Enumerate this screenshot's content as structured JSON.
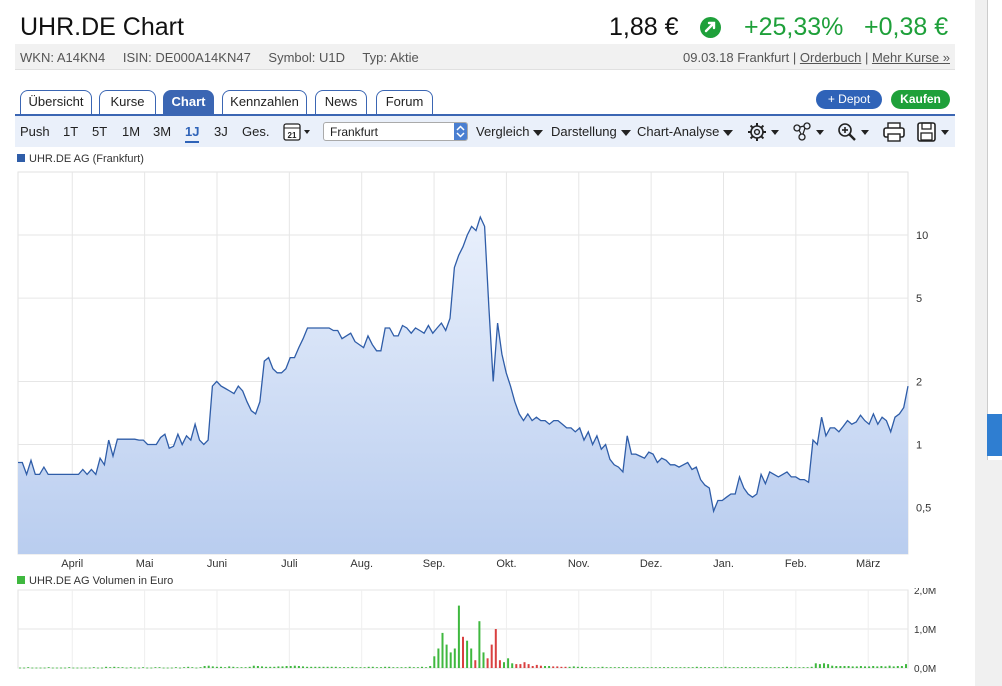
{
  "header": {
    "title": "UHR.DE Chart",
    "price": "1,88 €",
    "change_pct": "+25,33%",
    "change_abs": "+0,38 €",
    "wkn": "WKN: A14KN4",
    "isin": "ISIN: DE000A14KN47",
    "symbol": "Symbol: U1D",
    "typ": "Typ: Aktie",
    "date_place": "09.03.18 Frankfurt",
    "orderbuch": "Orderbuch",
    "mehr_kurse": "Mehr Kurse »",
    "sep": "|",
    "colors": {
      "positive": "#1ea03a",
      "accent": "#2f63b8"
    }
  },
  "tabs": [
    "Übersicht",
    "Kurse",
    "Chart",
    "Kennzahlen",
    "News",
    "Forum"
  ],
  "active_tab": "Chart",
  "buttons": {
    "depot": "+ Depot",
    "kaufen": "Kaufen"
  },
  "toolbar": {
    "ranges": [
      "Push",
      "1T",
      "5T",
      "1M",
      "3M",
      "1J",
      "3J",
      "Ges."
    ],
    "active_range": "1J",
    "calendar_day": "21",
    "exchange_select": "Frankfurt",
    "vergleich": "Vergleich",
    "darstellung": "Darstellung",
    "chartanalyse": "Chart-Analyse",
    "icons": [
      "settings-icon",
      "share-icon",
      "zoom-icon",
      "print-icon",
      "save-icon"
    ]
  },
  "chart_data": [
    {
      "type": "area",
      "series": [
        {
          "name": "UHR.DE AG (Frankfurt)",
          "color": "#2f5da8"
        }
      ],
      "x_ticks": [
        "April",
        "Mai",
        "Juni",
        "Juli",
        "Aug.",
        "Sep.",
        "Okt.",
        "Nov.",
        "Dez.",
        "Jan.",
        "Feb.",
        "März"
      ],
      "y_ticks": [
        "10",
        "5",
        "2",
        "1",
        "0,5"
      ],
      "y_scale": "log",
      "ylim": [
        0.3,
        20
      ],
      "values": [
        0.82,
        0.82,
        0.72,
        0.84,
        0.72,
        0.72,
        0.78,
        0.72,
        0.72,
        0.72,
        0.72,
        0.72,
        0.72,
        0.72,
        0.72,
        0.76,
        0.72,
        0.76,
        0.72,
        0.86,
        0.8,
        1.05,
        0.88,
        1.06,
        1.06,
        1.06,
        1.06,
        1.06,
        1.05,
        1.05,
        1.0,
        1.0,
        1.0,
        1.08,
        1.12,
        0.96,
        0.98,
        1.12,
        1.0,
        1.1,
        1.05,
        1.25,
        1.05,
        1.0,
        1.05,
        1.9,
        2.0,
        1.9,
        1.85,
        1.8,
        1.75,
        1.9,
        1.8,
        1.6,
        1.45,
        1.4,
        1.6,
        2.5,
        2.6,
        2.3,
        2.2,
        2.2,
        2.3,
        2.6,
        2.6,
        2.9,
        3.2,
        3.6,
        3.6,
        3.6,
        3.6,
        3.6,
        3.6,
        3.5,
        3.5,
        3.2,
        3.3,
        3.4,
        3.1,
        3.0,
        2.9,
        3.3,
        3.0,
        2.8,
        2.8,
        3.6,
        3.6,
        3.3,
        3.3,
        3.7,
        3.6,
        3.4,
        3.6,
        3.5,
        3.4,
        3.7,
        3.4,
        3.6,
        3.8,
        3.5,
        4.0,
        7.0,
        8.0,
        8.8,
        10.0,
        11.0,
        10.5,
        12.2,
        11.0,
        4.5,
        2.0,
        3.8,
        2.7,
        2.2,
        1.9,
        1.6,
        1.4,
        1.3,
        1.4,
        1.3,
        1.35,
        1.3,
        1.3,
        1.25,
        1.3,
        1.3,
        1.25,
        1.2,
        1.2,
        1.15,
        1.2,
        1.05,
        1.15,
        1.0,
        1.1,
        0.95,
        1.0,
        0.85,
        0.8,
        0.78,
        0.74,
        1.1,
        0.9,
        0.9,
        0.88,
        0.86,
        0.92,
        0.9,
        0.82,
        0.86,
        0.84,
        0.8,
        0.8,
        0.78,
        0.8,
        0.82,
        0.76,
        0.78,
        0.68,
        0.64,
        0.62,
        0.48,
        0.54,
        0.54,
        0.56,
        0.58,
        0.58,
        0.7,
        0.62,
        0.58,
        0.56,
        0.58,
        0.72,
        0.65,
        0.74,
        0.72,
        0.7,
        0.72,
        0.74,
        0.7,
        0.7,
        0.68,
        0.68,
        0.66,
        1.05,
        1.0,
        1.35,
        1.1,
        1.2,
        1.2,
        1.15,
        1.22,
        1.3,
        1.25,
        1.28,
        1.38,
        1.3,
        1.25,
        1.4,
        1.25,
        1.35,
        1.3,
        1.15,
        1.35,
        1.4,
        1.5,
        1.9
      ]
    },
    {
      "type": "bar",
      "series": [
        {
          "name": "UHR.DE AG Volumen in Euro",
          "color_up": "#3fb83f",
          "color_down": "#d94040"
        }
      ],
      "y_ticks": [
        "2,0M",
        "1,0M",
        "0,0M"
      ],
      "ylim": [
        0,
        2.0
      ],
      "unit": "M",
      "values": [
        0.01,
        0.01,
        0.02,
        0.01,
        0.01,
        0.01,
        0.01,
        0.02,
        0.01,
        0.01,
        0.01,
        0.01,
        0.02,
        0.01,
        0.01,
        0.01,
        0.01,
        0.01,
        0.02,
        0.01,
        0.01,
        0.03,
        0.02,
        0.03,
        0.02,
        0.02,
        0.01,
        0.02,
        0.01,
        0.01,
        0.02,
        0.01,
        0.01,
        0.02,
        0.02,
        0.01,
        0.01,
        0.01,
        0.02,
        0.01,
        0.02,
        0.03,
        0.02,
        0.01,
        0.02,
        0.05,
        0.06,
        0.04,
        0.03,
        0.03,
        0.02,
        0.04,
        0.03,
        0.02,
        0.02,
        0.02,
        0.03,
        0.06,
        0.05,
        0.04,
        0.03,
        0.03,
        0.03,
        0.04,
        0.04,
        0.05,
        0.05,
        0.06,
        0.05,
        0.04,
        0.03,
        0.03,
        0.03,
        0.03,
        0.03,
        0.03,
        0.03,
        0.03,
        0.02,
        0.02,
        0.02,
        0.03,
        0.02,
        0.02,
        0.02,
        0.03,
        0.03,
        0.02,
        0.02,
        0.03,
        0.03,
        0.02,
        0.02,
        0.02,
        0.02,
        0.03,
        0.02,
        0.02,
        0.03,
        0.02,
        0.05,
        0.3,
        0.5,
        0.9,
        0.6,
        0.4,
        0.5,
        1.6,
        0.8,
        0.7,
        0.5,
        0.2,
        1.2,
        0.4,
        0.25,
        0.6,
        1.0,
        0.2,
        0.15,
        0.25,
        0.12,
        0.1,
        0.1,
        0.15,
        0.1,
        0.05,
        0.08,
        0.06,
        0.05,
        0.05,
        0.04,
        0.04,
        0.03,
        0.03,
        0.03,
        0.04,
        0.03,
        0.03,
        0.02,
        0.02,
        0.02,
        0.02,
        0.03,
        0.02,
        0.02,
        0.02,
        0.02,
        0.02,
        0.02,
        0.02,
        0.02,
        0.02,
        0.02,
        0.02,
        0.02,
        0.02,
        0.02,
        0.02,
        0.02,
        0.02,
        0.02,
        0.02,
        0.02,
        0.02,
        0.02,
        0.03,
        0.02,
        0.02,
        0.02,
        0.02,
        0.02,
        0.02,
        0.03,
        0.02,
        0.02,
        0.02,
        0.02,
        0.02,
        0.02,
        0.02,
        0.02,
        0.02,
        0.02,
        0.02,
        0.02,
        0.02,
        0.02,
        0.03,
        0.02,
        0.02,
        0.02,
        0.02,
        0.02,
        0.03,
        0.12,
        0.1,
        0.12,
        0.1,
        0.06,
        0.05,
        0.05,
        0.05,
        0.05,
        0.04,
        0.04,
        0.05,
        0.04,
        0.04,
        0.05,
        0.04,
        0.05,
        0.04,
        0.06,
        0.04,
        0.05,
        0.05,
        0.1
      ],
      "down_index": [
        108,
        111,
        114,
        115,
        116,
        117,
        121,
        122,
        123,
        124,
        125,
        126,
        127,
        130,
        131,
        132,
        133
      ]
    }
  ]
}
